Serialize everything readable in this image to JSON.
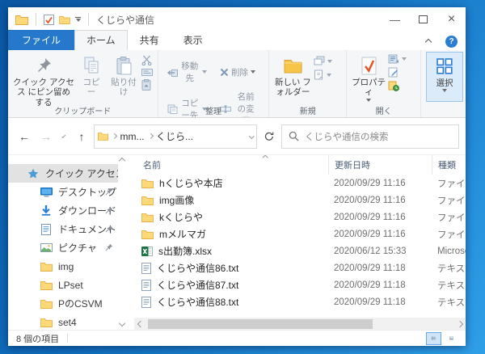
{
  "window": {
    "title": "くじらや通信"
  },
  "tabs": {
    "items": [
      "ファイル",
      "ホーム",
      "共有",
      "表示"
    ],
    "active": "ホーム"
  },
  "ribbon": {
    "pin_button": "クイック アクセス にピン留めする",
    "copy": "コピー",
    "paste": "貼り付け",
    "move_to": "移動先",
    "copy_to": "コピー先",
    "delete": "削除",
    "rename": "名前の変更",
    "new_folder": "新しい フォルダー",
    "properties": "プロパティ",
    "select": "選択",
    "groups": {
      "clipboard": "クリップボード",
      "organize": "整理",
      "new": "新規",
      "open": "開く"
    }
  },
  "address": {
    "crumbs": [
      "mm...",
      "くじら..."
    ],
    "search_placeholder": "くじらや通信の検索"
  },
  "sidebar": {
    "items": [
      {
        "label": "クイック アクセス",
        "icon": "star-icon",
        "selected": true
      },
      {
        "label": "デスクトップ",
        "icon": "desktop-icon",
        "pinned": true
      },
      {
        "label": "ダウンロード",
        "icon": "download-icon",
        "pinned": true
      },
      {
        "label": "ドキュメント",
        "icon": "document-icon",
        "pinned": true
      },
      {
        "label": "ピクチャ",
        "icon": "pictures-icon",
        "pinned": true
      },
      {
        "label": "img",
        "icon": "folder-icon"
      },
      {
        "label": "LPset",
        "icon": "folder-icon"
      },
      {
        "label": "PのCSVM",
        "icon": "folder-icon"
      },
      {
        "label": "set4",
        "icon": "folder-icon"
      }
    ]
  },
  "filelist": {
    "columns": {
      "name": "名前",
      "date": "更新日時",
      "type": "種類"
    },
    "rows": [
      {
        "name": "hくじらや本店",
        "date": "2020/09/29 11:16",
        "type": "ファイル フォ",
        "icon": "folder-icon"
      },
      {
        "name": "img画像",
        "date": "2020/09/29 11:16",
        "type": "ファイル フォ",
        "icon": "folder-icon"
      },
      {
        "name": "kくじらや",
        "date": "2020/09/29 11:16",
        "type": "ファイル フォ",
        "icon": "folder-icon"
      },
      {
        "name": "mメルマガ",
        "date": "2020/09/29 11:16",
        "type": "ファイル フォ",
        "icon": "folder-icon"
      },
      {
        "name": "s出勤簿.xlsx",
        "date": "2020/06/12 15:33",
        "type": "Microsoft",
        "icon": "excel-icon"
      },
      {
        "name": "くじらや通信86.txt",
        "date": "2020/09/29 11:18",
        "type": "テキスト ド",
        "icon": "text-file-icon"
      },
      {
        "name": "くじらや通信87.txt",
        "date": "2020/09/29 11:18",
        "type": "テキスト ド",
        "icon": "text-file-icon"
      },
      {
        "name": "くじらや通信88.txt",
        "date": "2020/09/29 11:18",
        "type": "テキスト ド",
        "icon": "text-file-icon"
      }
    ]
  },
  "statusbar": {
    "items_count": "8 個の項目"
  },
  "icons": {
    "minimize": "—",
    "close": "×",
    "back": "←",
    "forward": "→",
    "up": "↑"
  },
  "colors": {
    "accent": "#2679ca",
    "folder": "#ffd978",
    "excel_green": "#1a7343",
    "check_orange": "#e2572b"
  }
}
